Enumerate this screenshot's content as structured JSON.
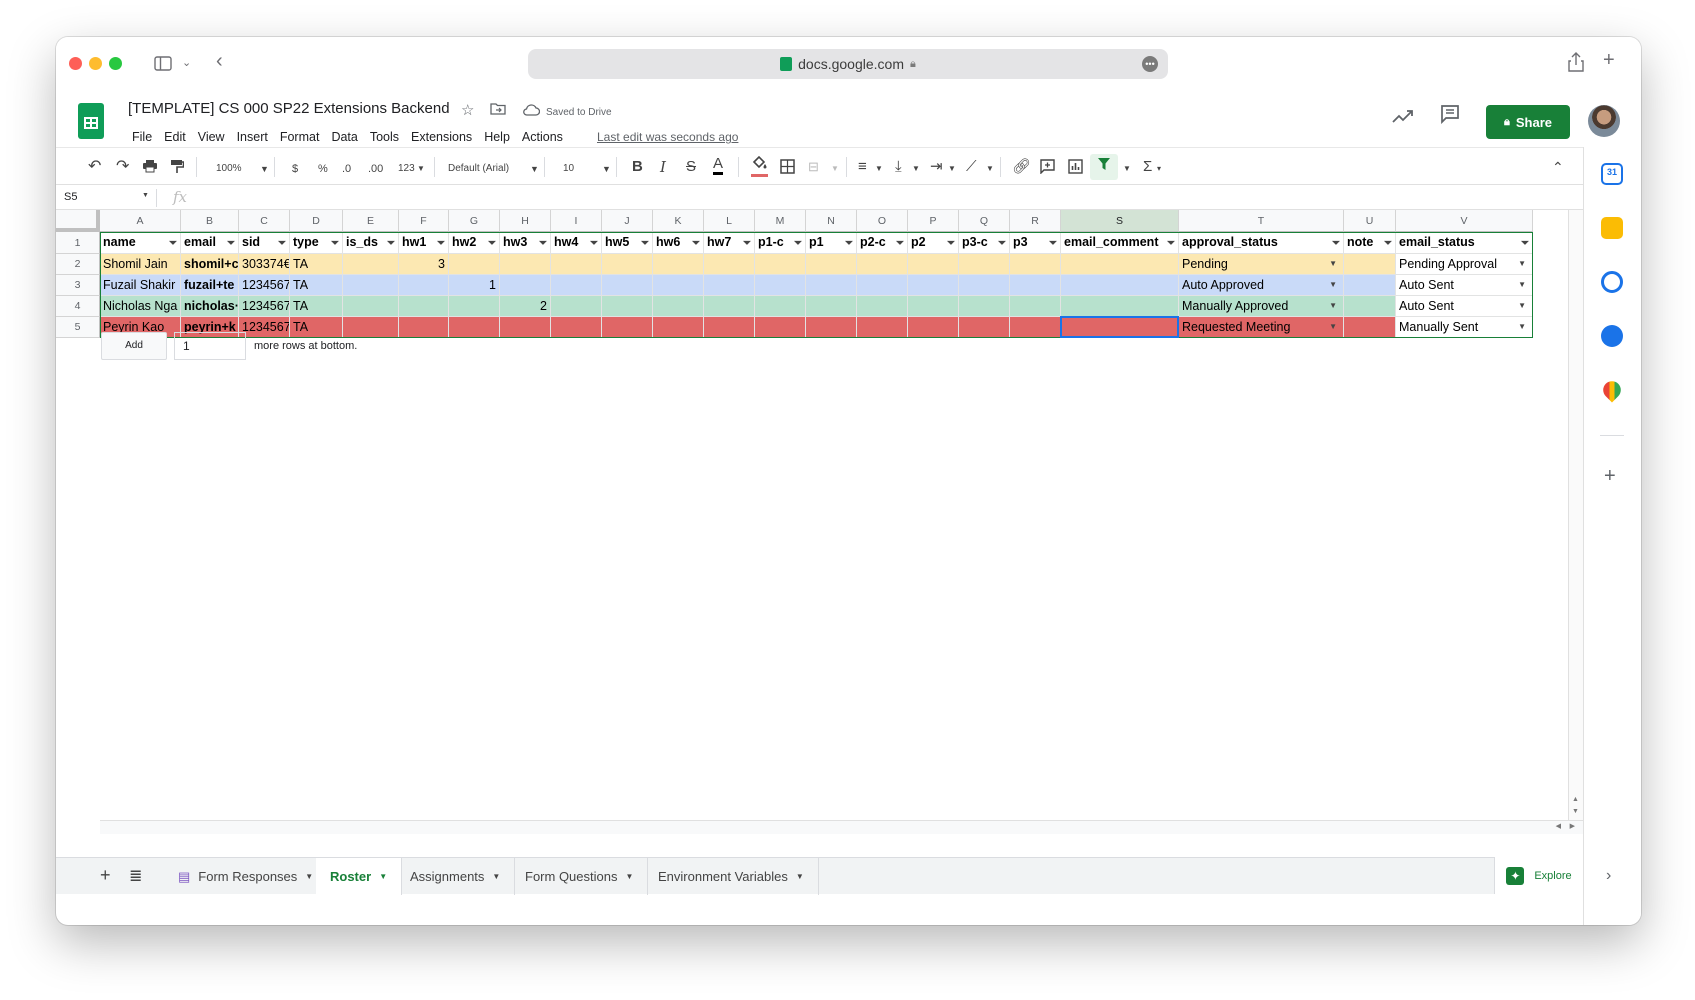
{
  "browser": {
    "url": "docs.google.com"
  },
  "app": {
    "doc_title": "[TEMPLATE] CS 000 SP22 Extensions Backend",
    "saved_status": "Saved to Drive",
    "menu": [
      "File",
      "Edit",
      "View",
      "Insert",
      "Format",
      "Data",
      "Tools",
      "Extensions",
      "Help",
      "Actions"
    ],
    "last_edit": "Last edit was seconds ago",
    "share_label": "Share"
  },
  "toolbar": {
    "zoom": "100%",
    "currency": "$",
    "percent": "%",
    "dec_decrease": ".0",
    "dec_increase": ".00",
    "more_formats": "123",
    "font": "Default (Arial)",
    "font_size": "10"
  },
  "formula_bar": {
    "name_box": "S5",
    "fx": "fx",
    "value": ""
  },
  "grid": {
    "columns": [
      "A",
      "B",
      "C",
      "D",
      "E",
      "F",
      "G",
      "H",
      "I",
      "J",
      "K",
      "L",
      "M",
      "N",
      "O",
      "P",
      "Q",
      "R",
      "S",
      "T",
      "U",
      "V"
    ],
    "selected_column": "S",
    "row_numbers": [
      "1",
      "2",
      "3",
      "4",
      "5"
    ],
    "headers": [
      "name",
      "email",
      "sid",
      "type",
      "is_ds",
      "hw1",
      "hw2",
      "hw3",
      "hw4",
      "hw5",
      "hw6",
      "hw7",
      "p1-c",
      "p1",
      "p2-c",
      "p2",
      "p3-c",
      "p3",
      "email_comment",
      "approval_status",
      "note",
      "email_status"
    ],
    "rows": [
      {
        "color": "#fce8b2",
        "cells": [
          "Shomil Jain",
          "shomil+c",
          "303374€",
          "TA",
          "",
          "3",
          "",
          "",
          "",
          "",
          "",
          "",
          "",
          "",
          "",
          "",
          "",
          "",
          "",
          "Pending",
          "",
          "Pending Approval"
        ]
      },
      {
        "color": "#c9daf8",
        "cells": [
          "Fuzail Shakir",
          "fuzail+te",
          "1234567",
          "TA",
          "",
          "",
          "1",
          "",
          "",
          "",
          "",
          "",
          "",
          "",
          "",
          "",
          "",
          "",
          "",
          "Auto Approved",
          "",
          "Auto Sent"
        ]
      },
      {
        "color": "#b7e1cd",
        "cells": [
          "Nicholas Nga",
          "nicholas·",
          "1234567",
          "TA",
          "",
          "",
          "",
          "2",
          "",
          "",
          "",
          "",
          "",
          "",
          "",
          "",
          "",
          "",
          "",
          "Manually Approved",
          "",
          "Auto Sent"
        ]
      },
      {
        "color": "#e06666",
        "cells": [
          "Peyrin Kao",
          "peyrin+k",
          "1234567",
          "TA",
          "",
          "",
          "",
          "",
          "",
          "",
          "",
          "",
          "",
          "",
          "",
          "",
          "",
          "",
          "",
          "Requested Meeting",
          "",
          "Manually Sent"
        ]
      }
    ],
    "add_rows": {
      "button": "Add",
      "count": "1",
      "suffix": "more rows at bottom."
    }
  },
  "sheet_tabs": [
    {
      "label": "Form Responses",
      "active": false
    },
    {
      "label": "Roster",
      "active": true
    },
    {
      "label": "Assignments",
      "active": false
    },
    {
      "label": "Form Questions",
      "active": false
    },
    {
      "label": "Environment Variables",
      "active": false
    }
  ],
  "explore_label": "Explore",
  "colors": {
    "brand_green": "#188038",
    "selection_blue": "#1a73e8"
  }
}
